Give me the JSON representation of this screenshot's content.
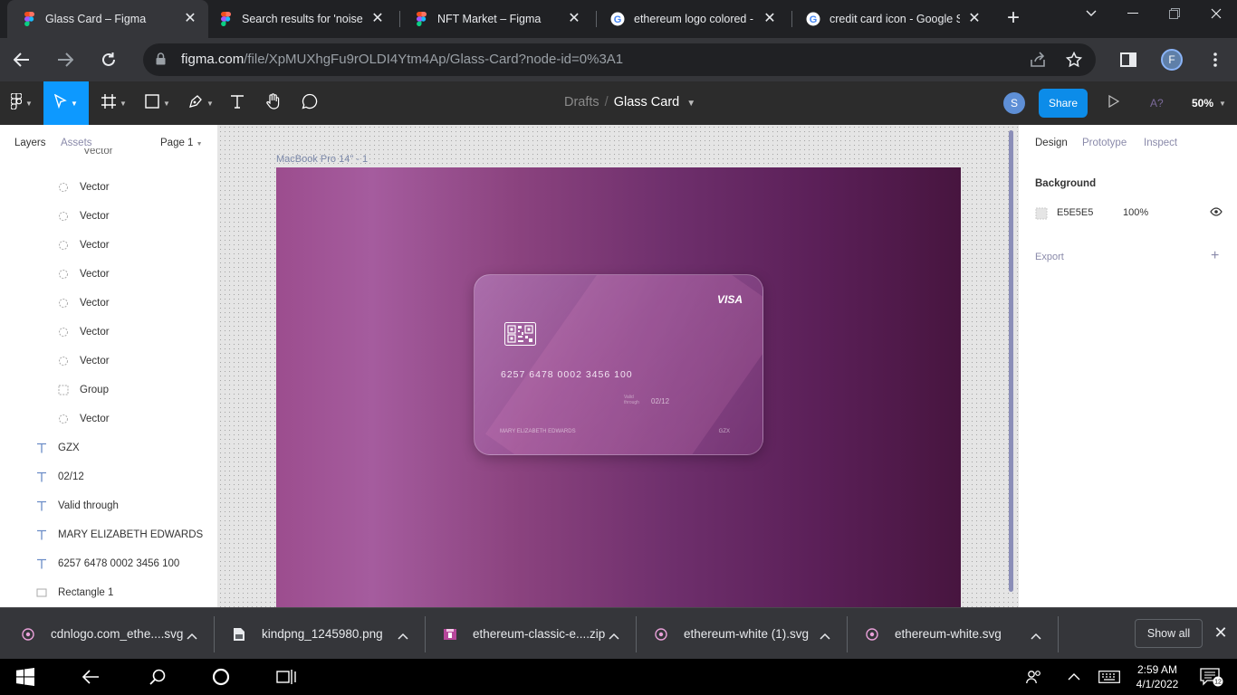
{
  "browser": {
    "tabs": [
      {
        "title": "Glass Card – Figma",
        "favicon": "figma-icon",
        "active": true
      },
      {
        "title": "Search results for 'noise' –",
        "favicon": "figma-icon",
        "active": false
      },
      {
        "title": "NFT Market – Figma",
        "favicon": "figma-icon",
        "active": false
      },
      {
        "title": "ethereum logo colored - G",
        "favicon": "google-icon",
        "active": false
      },
      {
        "title": "credit card icon - Google S",
        "favicon": "google-icon",
        "active": false
      }
    ],
    "new_tab_label": "+",
    "url_host": "figma.com",
    "url_path": "/file/XpMUXhgFu9rOLDI4Ytm4Ap/Glass-Card?node-id=0%3A1",
    "profile_initial": "F"
  },
  "figma": {
    "breadcrumb_folder": "Drafts",
    "breadcrumb_sep": "/",
    "file_name": "Glass Card",
    "user_initial": "S",
    "share_label": "Share",
    "ai_label": "A?",
    "zoom": "50%",
    "left": {
      "tab_layers": "Layers",
      "tab_assets": "Assets",
      "page_label": "Page 1",
      "layers": [
        {
          "name": "Vector",
          "icon": "vector-icon"
        },
        {
          "name": "Vector",
          "icon": "vector-icon"
        },
        {
          "name": "Vector",
          "icon": "vector-icon"
        },
        {
          "name": "Vector",
          "icon": "vector-icon"
        },
        {
          "name": "Vector",
          "icon": "vector-icon"
        },
        {
          "name": "Vector",
          "icon": "vector-icon"
        },
        {
          "name": "Vector",
          "icon": "vector-icon"
        },
        {
          "name": "Vector",
          "icon": "vector-icon"
        },
        {
          "name": "Group",
          "icon": "group-icon"
        },
        {
          "name": "Vector",
          "icon": "vector-icon"
        },
        {
          "name": "GZX",
          "icon": "text-icon"
        },
        {
          "name": "02/12",
          "icon": "text-icon"
        },
        {
          "name": "Valid through",
          "icon": "text-icon"
        },
        {
          "name": "MARY ELIZABETH EDWARDS",
          "icon": "text-icon"
        },
        {
          "name": "6257 6478 0002 3456 100",
          "icon": "text-icon"
        },
        {
          "name": "Rectangle 1",
          "icon": "rectangle-icon"
        }
      ]
    },
    "canvas": {
      "frame_label": "MacBook Pro 14\" - 1",
      "card": {
        "brand": "VISA",
        "number": "6257 6478 0002 3456 100",
        "valid_label": "Valid through",
        "expiry": "02/12",
        "holder": "MARY ELIZABETH EDWARDS",
        "code": "GZX"
      },
      "help_label": "?"
    },
    "right": {
      "tab_design": "Design",
      "tab_prototype": "Prototype",
      "tab_inspect": "Inspect",
      "background_heading": "Background",
      "bg_hex": "E5E5E5",
      "bg_opacity": "100%",
      "export_label": "Export",
      "export_add": "+"
    }
  },
  "downloads": {
    "items": [
      {
        "name": "cdnlogo.com_ethe....svg",
        "icon": "svg-file-icon"
      },
      {
        "name": "kindpng_1245980.png",
        "icon": "png-file-icon"
      },
      {
        "name": "ethereum-classic-e....zip",
        "icon": "zip-file-icon"
      },
      {
        "name": "ethereum-white (1).svg",
        "icon": "svg-file-icon"
      },
      {
        "name": "ethereum-white.svg",
        "icon": "svg-file-icon"
      }
    ],
    "show_all_label": "Show all"
  },
  "taskbar": {
    "time": "2:59 AM",
    "date": "4/1/2022",
    "notification_count": "12"
  },
  "colors": {
    "figma_blue": "#0d99ff",
    "share_blue": "#0c8ce9",
    "canvas_bg": "#E5E5E5",
    "frame_gradient_start": "#9c4d8e",
    "frame_gradient_end": "#47153f"
  }
}
